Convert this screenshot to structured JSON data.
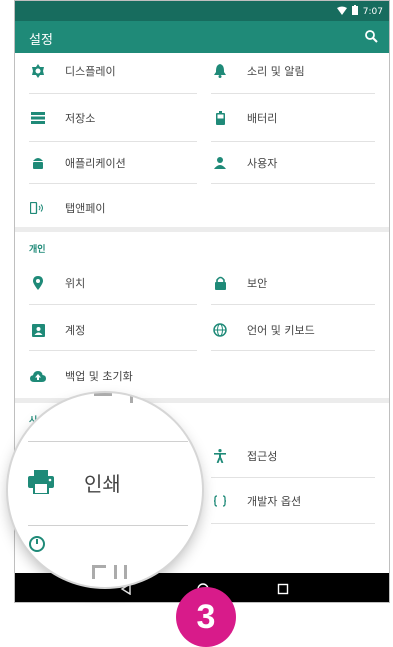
{
  "status_bar": {
    "time": "7:07"
  },
  "app_bar": {
    "title": "설정",
    "search_icon": "search-icon"
  },
  "device": {
    "items": [
      {
        "label": "디스플레이",
        "icon": "brightness-icon"
      },
      {
        "label": "소리 및 알림",
        "icon": "bell-icon"
      },
      {
        "label": "저장소",
        "icon": "storage-icon"
      },
      {
        "label": "배터리",
        "icon": "battery-icon"
      },
      {
        "label": "애플리케이션",
        "icon": "android-icon"
      },
      {
        "label": "사용자",
        "icon": "person-icon"
      },
      {
        "label": "탭앤페이",
        "icon": "nfc-tap-icon"
      }
    ]
  },
  "personal": {
    "title": "개인",
    "items": [
      {
        "label": "위치",
        "icon": "location-icon"
      },
      {
        "label": "보안",
        "icon": "lock-icon"
      },
      {
        "label": "계정",
        "icon": "account-box-icon"
      },
      {
        "label": "언어 및 키보드",
        "icon": "globe-icon"
      },
      {
        "label": "백업 및 초기화",
        "icon": "cloud-upload-icon"
      }
    ]
  },
  "system": {
    "title": "시스템",
    "items": [
      {
        "label": "접근성",
        "icon": "accessibility-icon"
      },
      {
        "label": "개발자 옵션",
        "icon": "code-braces-icon"
      }
    ]
  },
  "magnifier": {
    "label": "인쇄",
    "icon": "print-icon"
  },
  "badge": {
    "number": "3"
  },
  "colors": {
    "primary": "#1f8a78",
    "status_bar": "#176c5e",
    "accent_badge": "#d81b8a",
    "icon_gray": "#444444"
  }
}
